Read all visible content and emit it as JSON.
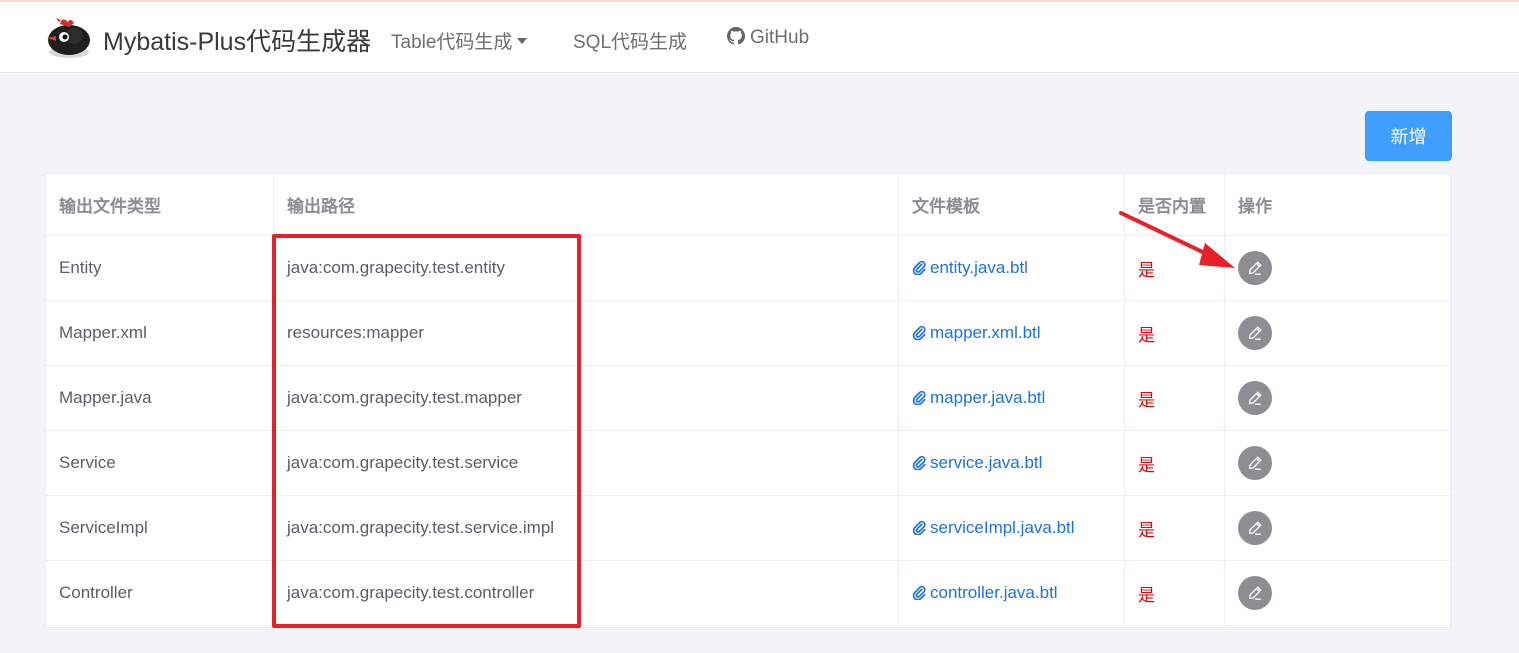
{
  "navbar": {
    "brand_title": "Mybatis-Plus代码生成器",
    "items": [
      {
        "label": "Table代码生成",
        "has_dropdown": true,
        "icon": ""
      },
      {
        "label": "SQL代码生成",
        "has_dropdown": false,
        "icon": ""
      },
      {
        "label": "GitHub",
        "has_dropdown": false,
        "icon": "github-icon"
      }
    ]
  },
  "toolbar": {
    "add_label": "新增"
  },
  "table": {
    "headers": {
      "type": "输出文件类型",
      "path": "输出路径",
      "template": "文件模板",
      "builtin": "是否内置",
      "operation": "操作"
    },
    "rows": [
      {
        "type": "Entity",
        "path": "java:com.grapecity.test.entity",
        "template": "entity.java.btl",
        "builtin": "是"
      },
      {
        "type": "Mapper.xml",
        "path": "resources:mapper",
        "template": "mapper.xml.btl",
        "builtin": "是"
      },
      {
        "type": "Mapper.java",
        "path": "java:com.grapecity.test.mapper",
        "template": "mapper.java.btl",
        "builtin": "是"
      },
      {
        "type": "Service",
        "path": "java:com.grapecity.test.service",
        "template": "service.java.btl",
        "builtin": "是"
      },
      {
        "type": "ServiceImpl",
        "path": "java:com.grapecity.test.service.impl",
        "template": "serviceImpl.java.btl",
        "builtin": "是"
      },
      {
        "type": "Controller",
        "path": "java:com.grapecity.test.controller",
        "template": "controller.java.btl",
        "builtin": "是"
      }
    ]
  },
  "colors": {
    "primary": "#409eff",
    "link": "#1f73d8",
    "builtin_yes": "#d40b0b",
    "annotation": "#e8202a",
    "edit_button": "#8e8e92"
  },
  "icons": {
    "template_link": "paperclip-icon",
    "operation": "pencil-icon"
  }
}
